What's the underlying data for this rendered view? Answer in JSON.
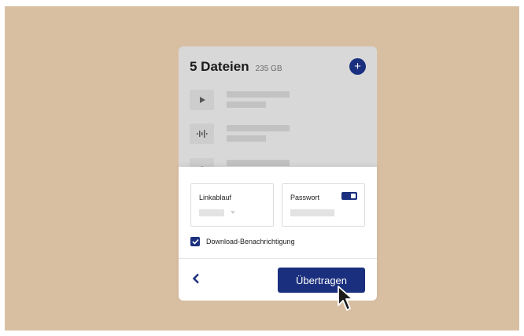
{
  "header": {
    "title": "5 Dateien",
    "size": "235 GB",
    "add_icon": "plus-icon"
  },
  "files": [
    {
      "icon": "play-icon"
    },
    {
      "icon": "audio-waveform-icon"
    },
    {
      "icon": "dot-icon"
    }
  ],
  "settings": {
    "expiry_label": "Linkablauf",
    "password_label": "Passwort",
    "password_toggle_on": true,
    "notify_label": "Download-Benachrichtigung",
    "notify_checked": true
  },
  "actions": {
    "back_icon": "chevron-left-icon",
    "submit_label": "Übertragen"
  },
  "colors": {
    "background": "#d8bfa2",
    "accent": "#1a2f7e",
    "card_back": "#d8d8d8",
    "panel": "#ffffff"
  }
}
